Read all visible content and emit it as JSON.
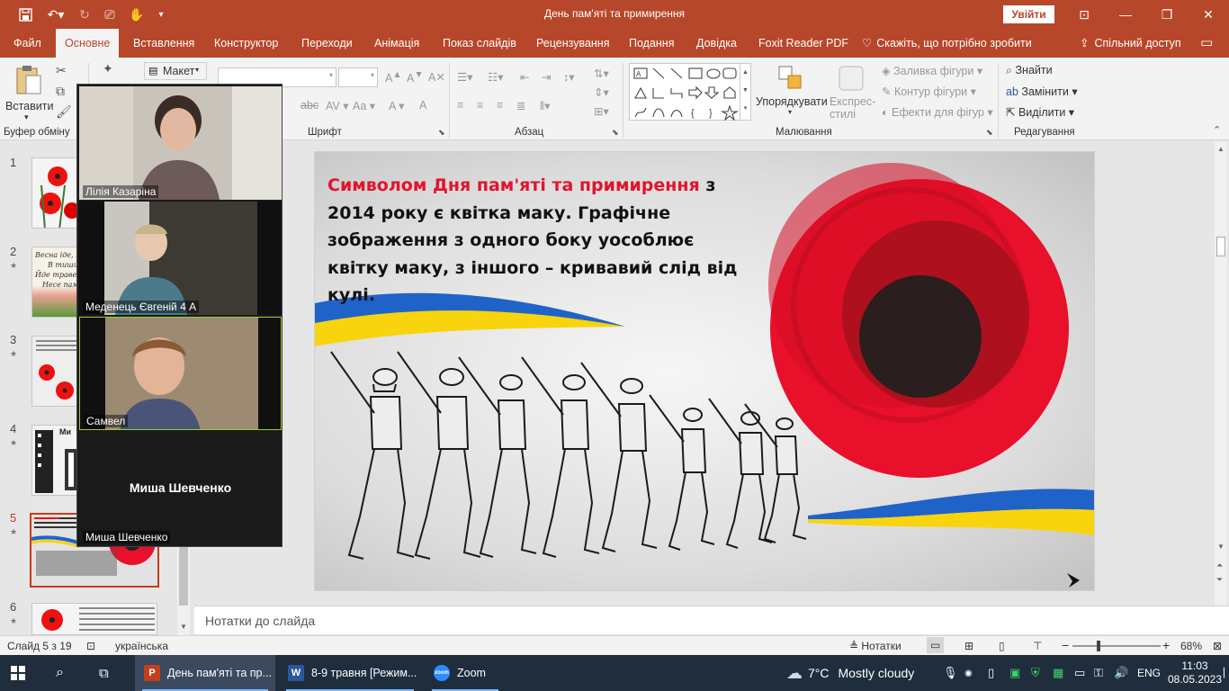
{
  "window": {
    "title": "День пам'яті та примирення",
    "signin_label": "Увійти"
  },
  "tabs": [
    {
      "label": "Файл"
    },
    {
      "label": "Основне"
    },
    {
      "label": "Вставлення"
    },
    {
      "label": "Конструктор"
    },
    {
      "label": "Переходи"
    },
    {
      "label": "Анімація"
    },
    {
      "label": "Показ слайдів"
    },
    {
      "label": "Рецензування"
    },
    {
      "label": "Подання"
    },
    {
      "label": "Довідка"
    },
    {
      "label": "Foxit Reader PDF"
    },
    {
      "label": "Скажіть, що потрібно зробити"
    },
    {
      "label": "Спільний доступ"
    }
  ],
  "ribbon": {
    "paste_label": "Вставити",
    "layout_label": "Макет",
    "arrange_label": "Упорядкувати",
    "quick_styles_label": "Експрес-стилі",
    "shape_fill_label": "Заливка фігури",
    "shape_outline_label": "Контур фігури",
    "shape_effects_label": "Ефекти для фігур",
    "find_label": "Знайти",
    "replace_label": "Замінити",
    "select_label": "Виділити",
    "groups": {
      "clipboard": "Буфер обміну",
      "font": "Шрифт",
      "paragraph": "Абзац",
      "drawing": "Малювання",
      "editing": "Редагування"
    }
  },
  "thumbnails": [
    {
      "number": "1",
      "star": ""
    },
    {
      "number": "2",
      "star": "★",
      "lines": [
        "Весна іде, к",
        "В тиши",
        "Йде травень",
        "Несе пам"
      ]
    },
    {
      "number": "3",
      "star": "★"
    },
    {
      "number": "4",
      "star": "★",
      "lines": [
        "Ми"
      ]
    },
    {
      "number": "5",
      "star": "★",
      "active": true
    },
    {
      "number": "6",
      "star": "★"
    }
  ],
  "zoom": {
    "participants": [
      {
        "name": "Лілія Казаріна"
      },
      {
        "name": "Меденець Євгеній 4 А"
      },
      {
        "name": "Самвел"
      },
      {
        "name": "Миша Шевченко",
        "center_name": "Миша Шевченко"
      }
    ]
  },
  "slide": {
    "highlight": "Символом Дня пам'яті та примирення",
    "text": " з 2014 року є квітка маку. Графічне зображення з одного боку уособлює квітку маку, з іншого – кривавий слід від кулі."
  },
  "notes": {
    "placeholder": "Нотатки до слайда"
  },
  "status": {
    "slide_counter": "Слайд 5 з 19",
    "language": "українська",
    "notes_label": "Нотатки",
    "zoom_level": "68%"
  },
  "taskbar": {
    "apps": [
      {
        "label": "День пам'яті та пр...",
        "icon": "P",
        "color": "#c43e1c"
      },
      {
        "label": "8-9 травня [Режим...",
        "icon": "W",
        "color": "#2b579a"
      },
      {
        "label": "Zoom",
        "icon": "zoom",
        "color": "#2d8cff"
      }
    ],
    "weather_temp": "7°C",
    "weather_text": "Mostly cloudy",
    "lang": "ENG",
    "time": "11:03",
    "date": "08.05.2023"
  },
  "colors": {
    "accent": "#b7472a",
    "slide_highlight": "#e2142b",
    "poppy_red": "#e8102a",
    "flag_blue": "#1f63c9",
    "flag_yellow": "#f7d40d"
  }
}
